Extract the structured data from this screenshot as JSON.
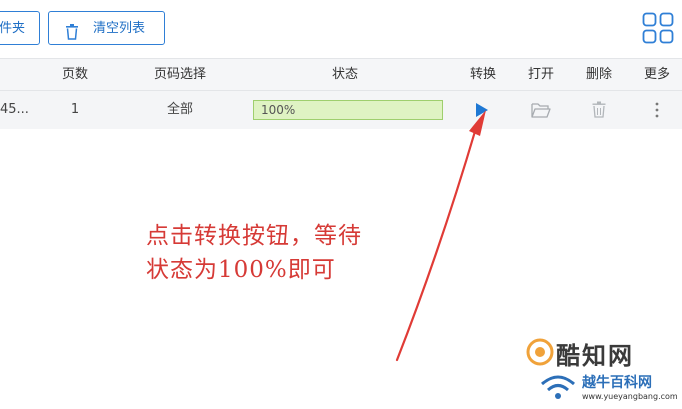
{
  "toolbar": {
    "add_folder_label": "件夹",
    "clear_list_label": "清空列表"
  },
  "table": {
    "columns": {
      "pages": "页数",
      "page_select": "页码选择",
      "status": "状态",
      "convert": "转换",
      "open": "打开",
      "delete": "删除",
      "more": "更多"
    },
    "rows": [
      {
        "name": "45...",
        "pages": "1",
        "page_select": "全部",
        "progress_text": "100%",
        "progress": 1.0
      }
    ]
  },
  "annotation": {
    "line1": "点击转换按钮，等待",
    "line2": "状态为100%即可"
  },
  "watermark": {
    "title": "酷知网",
    "subtitle": "越牛百科网",
    "url": "www.yueyangbang.com"
  },
  "colors": {
    "accent": "#2f7fd6",
    "annotation_red": "#d63a36",
    "progress_fill": "#dff3c3",
    "progress_border": "#9fcf6e"
  },
  "icons": {
    "clear": "trash-icon",
    "layout": "grid-icon",
    "convert": "play-icon",
    "open": "folder-open-icon",
    "delete": "trash-icon",
    "more": "vertical-dots-icon"
  }
}
